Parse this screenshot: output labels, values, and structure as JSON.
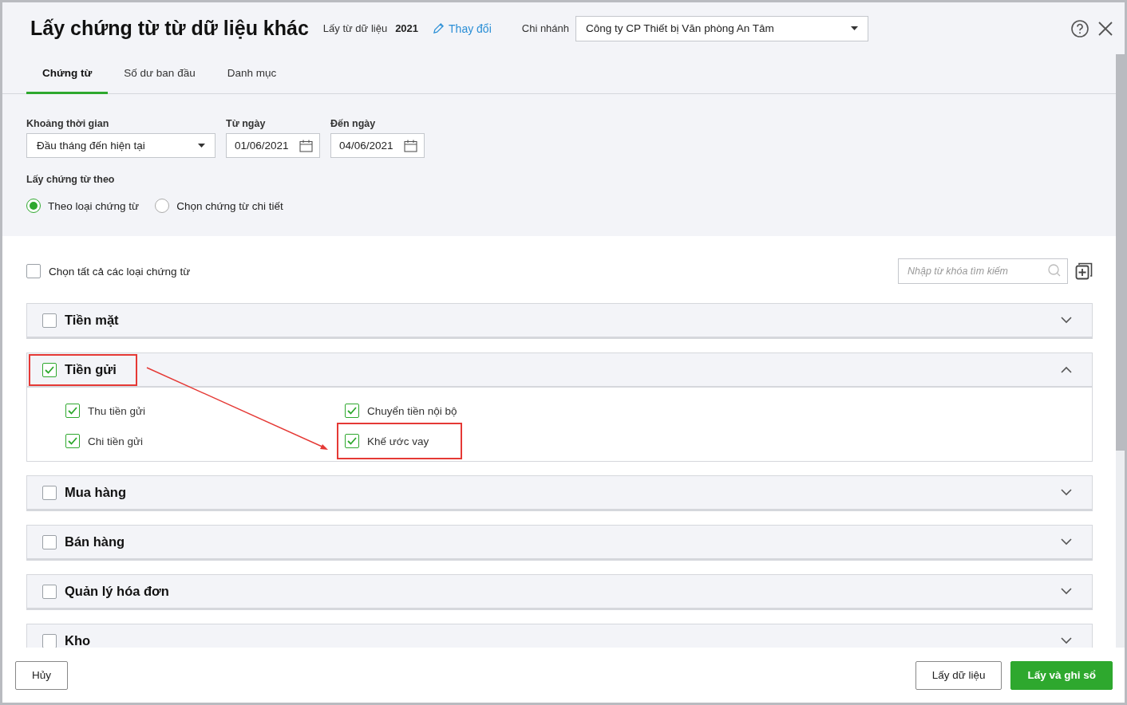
{
  "dialog": {
    "title": "Lấy chứng từ từ dữ liệu khác",
    "source_label": "Lấy từ dữ liệu",
    "source_value": "2021",
    "change_link": "Thay đổi",
    "branch_label": "Chi nhánh",
    "branch_value": "Công ty CP Thiết bị Văn phòng An Tâm"
  },
  "tabs": [
    {
      "label": "Chứng từ",
      "selected": true
    },
    {
      "label": "Số dư ban đầu",
      "selected": false
    },
    {
      "label": "Danh mục",
      "selected": false
    }
  ],
  "filters": {
    "period": {
      "label": "Khoảng thời gian",
      "value": "Đầu tháng đến hiện tại"
    },
    "from_date": {
      "label": "Từ ngày",
      "value": "01/06/2021"
    },
    "to_date": {
      "label": "Đến ngày",
      "value": "04/06/2021"
    }
  },
  "mode": {
    "label": "Lấy chứng từ theo",
    "options": [
      {
        "label": "Theo loại chứng từ",
        "selected": true
      },
      {
        "label": "Chọn chứng từ chi tiết",
        "selected": false
      }
    ]
  },
  "select_all": {
    "label": "Chọn tất cả các loại chứng từ",
    "checked": false
  },
  "search": {
    "placeholder": "Nhập từ khóa tìm kiếm"
  },
  "groups": [
    {
      "label": "Tiền mặt",
      "checked": false,
      "expanded": false,
      "highlighted": false
    },
    {
      "label": "Tiền gửi",
      "checked": true,
      "expanded": true,
      "highlighted": true,
      "items": [
        {
          "label": "Thu tiền gửi",
          "checked": true,
          "highlighted": false
        },
        {
          "label": "Chuyển tiền nội bộ",
          "checked": true,
          "highlighted": false
        },
        {
          "label": "Chi tiền gửi",
          "checked": true,
          "highlighted": false
        },
        {
          "label": "Khế ước vay",
          "checked": true,
          "highlighted": true
        }
      ]
    },
    {
      "label": "Mua hàng",
      "checked": false,
      "expanded": false,
      "highlighted": false
    },
    {
      "label": "Bán hàng",
      "checked": false,
      "expanded": false,
      "highlighted": false
    },
    {
      "label": "Quản lý hóa đơn",
      "checked": false,
      "expanded": false,
      "highlighted": false
    },
    {
      "label": "Kho",
      "checked": false,
      "expanded": false,
      "highlighted": false
    }
  ],
  "buttons": {
    "cancel": "Hủy",
    "fetch": "Lấy dữ liệu",
    "fetch_and_post": "Lấy và ghi sổ"
  }
}
